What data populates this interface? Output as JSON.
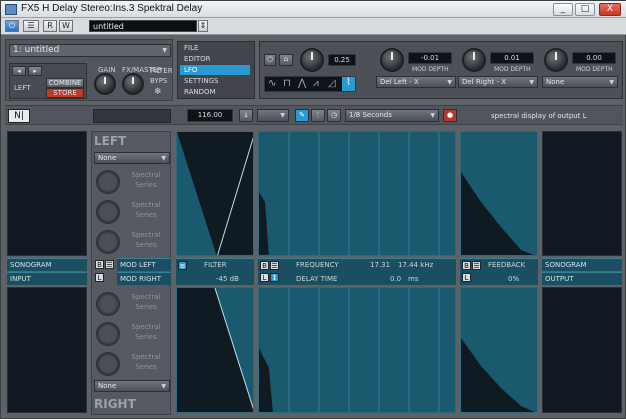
{
  "window": {
    "title": "FX5 H Delay Stereo:Ins.3   Spektral Delay",
    "min": "_",
    "max": "□",
    "close": "X"
  },
  "toolbar": {
    "power": "⏻",
    "bypass": "R",
    "write": "W",
    "preset": "untitled",
    "preset_arrow": "⇕"
  },
  "preset_select": "1:  untitled",
  "top_menu": {
    "items": [
      "FILE",
      "EDITOR",
      "LFO",
      "SETTINGS",
      "RANDOM"
    ],
    "selected": "LFO"
  },
  "left_controls": {
    "gain_label": "GAIN",
    "fx_label": "FX/MASTER",
    "combine": "COMBINE",
    "store": "STORE",
    "filter": "FILTER",
    "byps": "BYPS",
    "small_label": "LEFT"
  },
  "lfo": {
    "rate_value": "0.25",
    "mod_a_value": "-0.01",
    "mod_a_label": "MOD DEPTH",
    "mod_a_dest": "Del Left - X",
    "mod_b_value": "0.01",
    "mod_b_label": "MOD DEPTH",
    "mod_b_dest": "Del Right - X",
    "mod_c_value": "0.00",
    "mod_c_label": "MOD DEPTH",
    "mod_c_dest": "None"
  },
  "row2": {
    "tempo": "116.00",
    "time": "1/8 Seconds",
    "spectral_label": "spectral display of output L"
  },
  "left_section": {
    "title": "LEFT",
    "dropdown": "None",
    "slots": [
      "Spectral Series",
      "Spectral Series",
      "Spectral Series"
    ],
    "mod_left": "MOD LEFT",
    "mod_right": "MOD RIGHT"
  },
  "right_section": {
    "title": "RIGHT",
    "dropdown": "None",
    "slots": [
      "Spectral Series",
      "Spectral Series",
      "Spectral Series"
    ]
  },
  "strips": {
    "sonogram_left": "SONOGRAM",
    "input": "INPUT",
    "filter": "FILTER",
    "filter_val": "-45 dB",
    "frequency": "FREQUENCY",
    "freq_lo": "17.31",
    "freq_hi": "17.44 kHz",
    "delay_time": "DELAY TIME",
    "delay_val": "0.0",
    "delay_unit": "ms",
    "feedback": "FEEDBACK",
    "feedback_val": "0%",
    "sonogram_right": "SONOGRAM",
    "output": "OUTPUT"
  },
  "colors": {
    "accent": "#2a9ad4",
    "panel": "#5d6267",
    "display_bg": "#111a22",
    "teal": "#1b5a6e",
    "store_red": "#c0392b"
  }
}
